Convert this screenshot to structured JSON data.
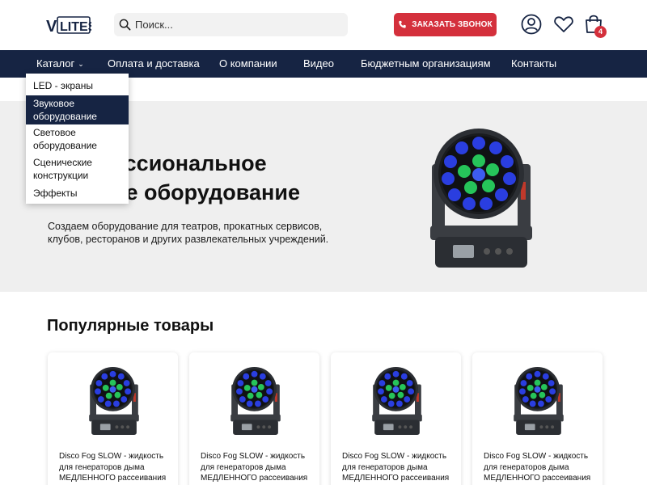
{
  "colors": {
    "accent": "#d4303c",
    "nav_bg": "#162443",
    "hero_bg": "#efefef"
  },
  "header": {
    "logo_text": "VLITES",
    "search_placeholder": "Поиск...",
    "call_button": "ЗАКАЗАТЬ ЗВОНОК",
    "cart_count": "4",
    "icons": [
      "search-icon",
      "phone-icon",
      "user-icon",
      "heart-icon",
      "cart-icon"
    ]
  },
  "nav": {
    "items": [
      {
        "label": "Каталог",
        "chevron": "⌄"
      },
      {
        "label": "Оплата и доставка"
      },
      {
        "label": "О компании"
      },
      {
        "label": "Видео"
      },
      {
        "label": "Бюджетным организациям"
      },
      {
        "label": "Контакты"
      }
    ]
  },
  "dropdown": {
    "items": [
      {
        "label": "LED - экраны"
      },
      {
        "label": "Звуковое оборудование"
      },
      {
        "label": "Световое оборудование"
      },
      {
        "label": "Сценические конструкции"
      },
      {
        "label": "Эффекты"
      }
    ]
  },
  "hero": {
    "title_line1": "ессиональное",
    "title_line2": "ое оборудование",
    "text": "Создаем оборудование для театров, прокатных сервисов, клубов, ресторанов и других развлекательных учреждений."
  },
  "popular": {
    "title": "Популярные товары",
    "cards": [
      {
        "name": "Disco Fog SLOW - жидкость для генераторов дыма МЕДЛЕННОГО рассеивания"
      },
      {
        "name": "Disco Fog SLOW - жидкость для генераторов дыма МЕДЛЕННОГО рассеивания"
      },
      {
        "name": "Disco Fog SLOW - жидкость для генераторов дыма МЕДЛЕННОГО рассеивания"
      },
      {
        "name": "Disco Fog SLOW - жидкость для генераторов дыма МЕДЛЕННОГО рассеивания"
      }
    ]
  }
}
